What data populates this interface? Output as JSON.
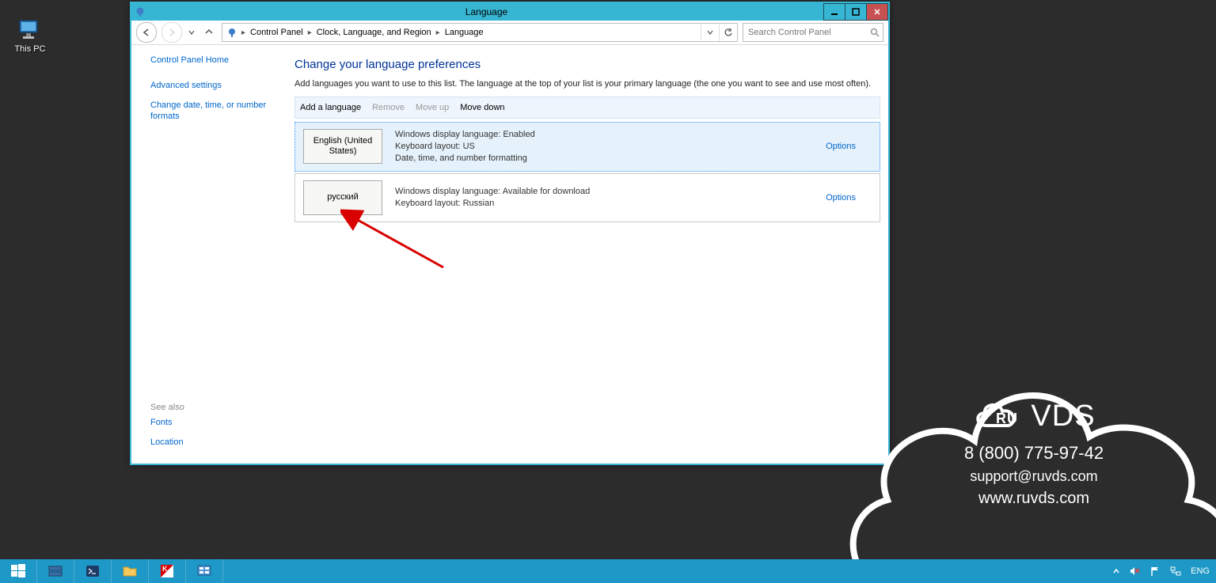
{
  "desktop": {
    "this_pc": "This PC"
  },
  "window": {
    "title": "Language",
    "breadcrumb": [
      "Control Panel",
      "Clock, Language, and Region",
      "Language"
    ],
    "search_placeholder": "Search Control Panel"
  },
  "sidebar": {
    "home": "Control Panel Home",
    "advanced": "Advanced settings",
    "datefmt": "Change date, time, or number formats",
    "see_also": "See also",
    "fonts": "Fonts",
    "location": "Location"
  },
  "main": {
    "heading": "Change your language preferences",
    "desc": "Add languages you want to use to this list. The language at the top of your list is your primary language (the one you want to see and use most often).",
    "cmd_add": "Add a language",
    "cmd_remove": "Remove",
    "cmd_moveup": "Move up",
    "cmd_movedown": "Move down",
    "options_label": "Options"
  },
  "langs": [
    {
      "name": "English (United States)",
      "info1": "Windows display language: Enabled",
      "info2": "Keyboard layout: US",
      "info3": "Date, time, and number formatting"
    },
    {
      "name": "русский",
      "info1": "Windows display language: Available for download",
      "info2": "Keyboard layout: Russian",
      "info3": ""
    }
  ],
  "watermark": {
    "brand1": "RU",
    "brand2": "VDS",
    "phone": "8 (800) 775-97-42",
    "email": "support@ruvds.com",
    "site": "www.ruvds.com"
  },
  "taskbar": {
    "lang": "ENG"
  }
}
